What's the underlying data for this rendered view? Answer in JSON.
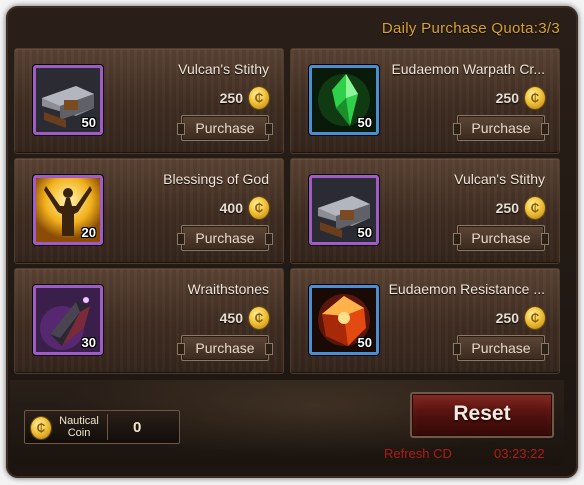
{
  "header": {
    "quota_text": "Daily Purchase Quota:3/3"
  },
  "items": [
    {
      "name": "Vulcan's Stithy",
      "price": "250",
      "quantity": "50",
      "button": "Purchase",
      "frame": "purple",
      "icon": "anvil-icon"
    },
    {
      "name": "Eudaemon Warpath Cr...",
      "price": "250",
      "quantity": "50",
      "button": "Purchase",
      "frame": "blue",
      "icon": "green-crystal-icon"
    },
    {
      "name": "Blessings of God",
      "price": "400",
      "quantity": "20",
      "button": "Purchase",
      "frame": "purple",
      "icon": "blessing-icon"
    },
    {
      "name": "Vulcan's Stithy",
      "price": "250",
      "quantity": "50",
      "button": "Purchase",
      "frame": "purple",
      "icon": "anvil-icon"
    },
    {
      "name": "Wraithstones",
      "price": "450",
      "quantity": "30",
      "button": "Purchase",
      "frame": "purple",
      "icon": "wraithstone-icon"
    },
    {
      "name": "Eudaemon Resistance ...",
      "price": "250",
      "quantity": "50",
      "button": "Purchase",
      "frame": "blue",
      "icon": "red-crystal-icon"
    }
  ],
  "currency": {
    "label_line1": "Nautical",
    "label_line2": "Coin",
    "value": "0",
    "icon": "gold-coin-icon"
  },
  "reset": {
    "label": "Reset",
    "refresh_label": "Refresh CD",
    "refresh_time": "03:23:22"
  },
  "colors": {
    "quota_text": "#d8a236",
    "refresh_text": "#b01c16",
    "purple_frame": "#a25ac8",
    "blue_frame": "#4a8fd3"
  }
}
